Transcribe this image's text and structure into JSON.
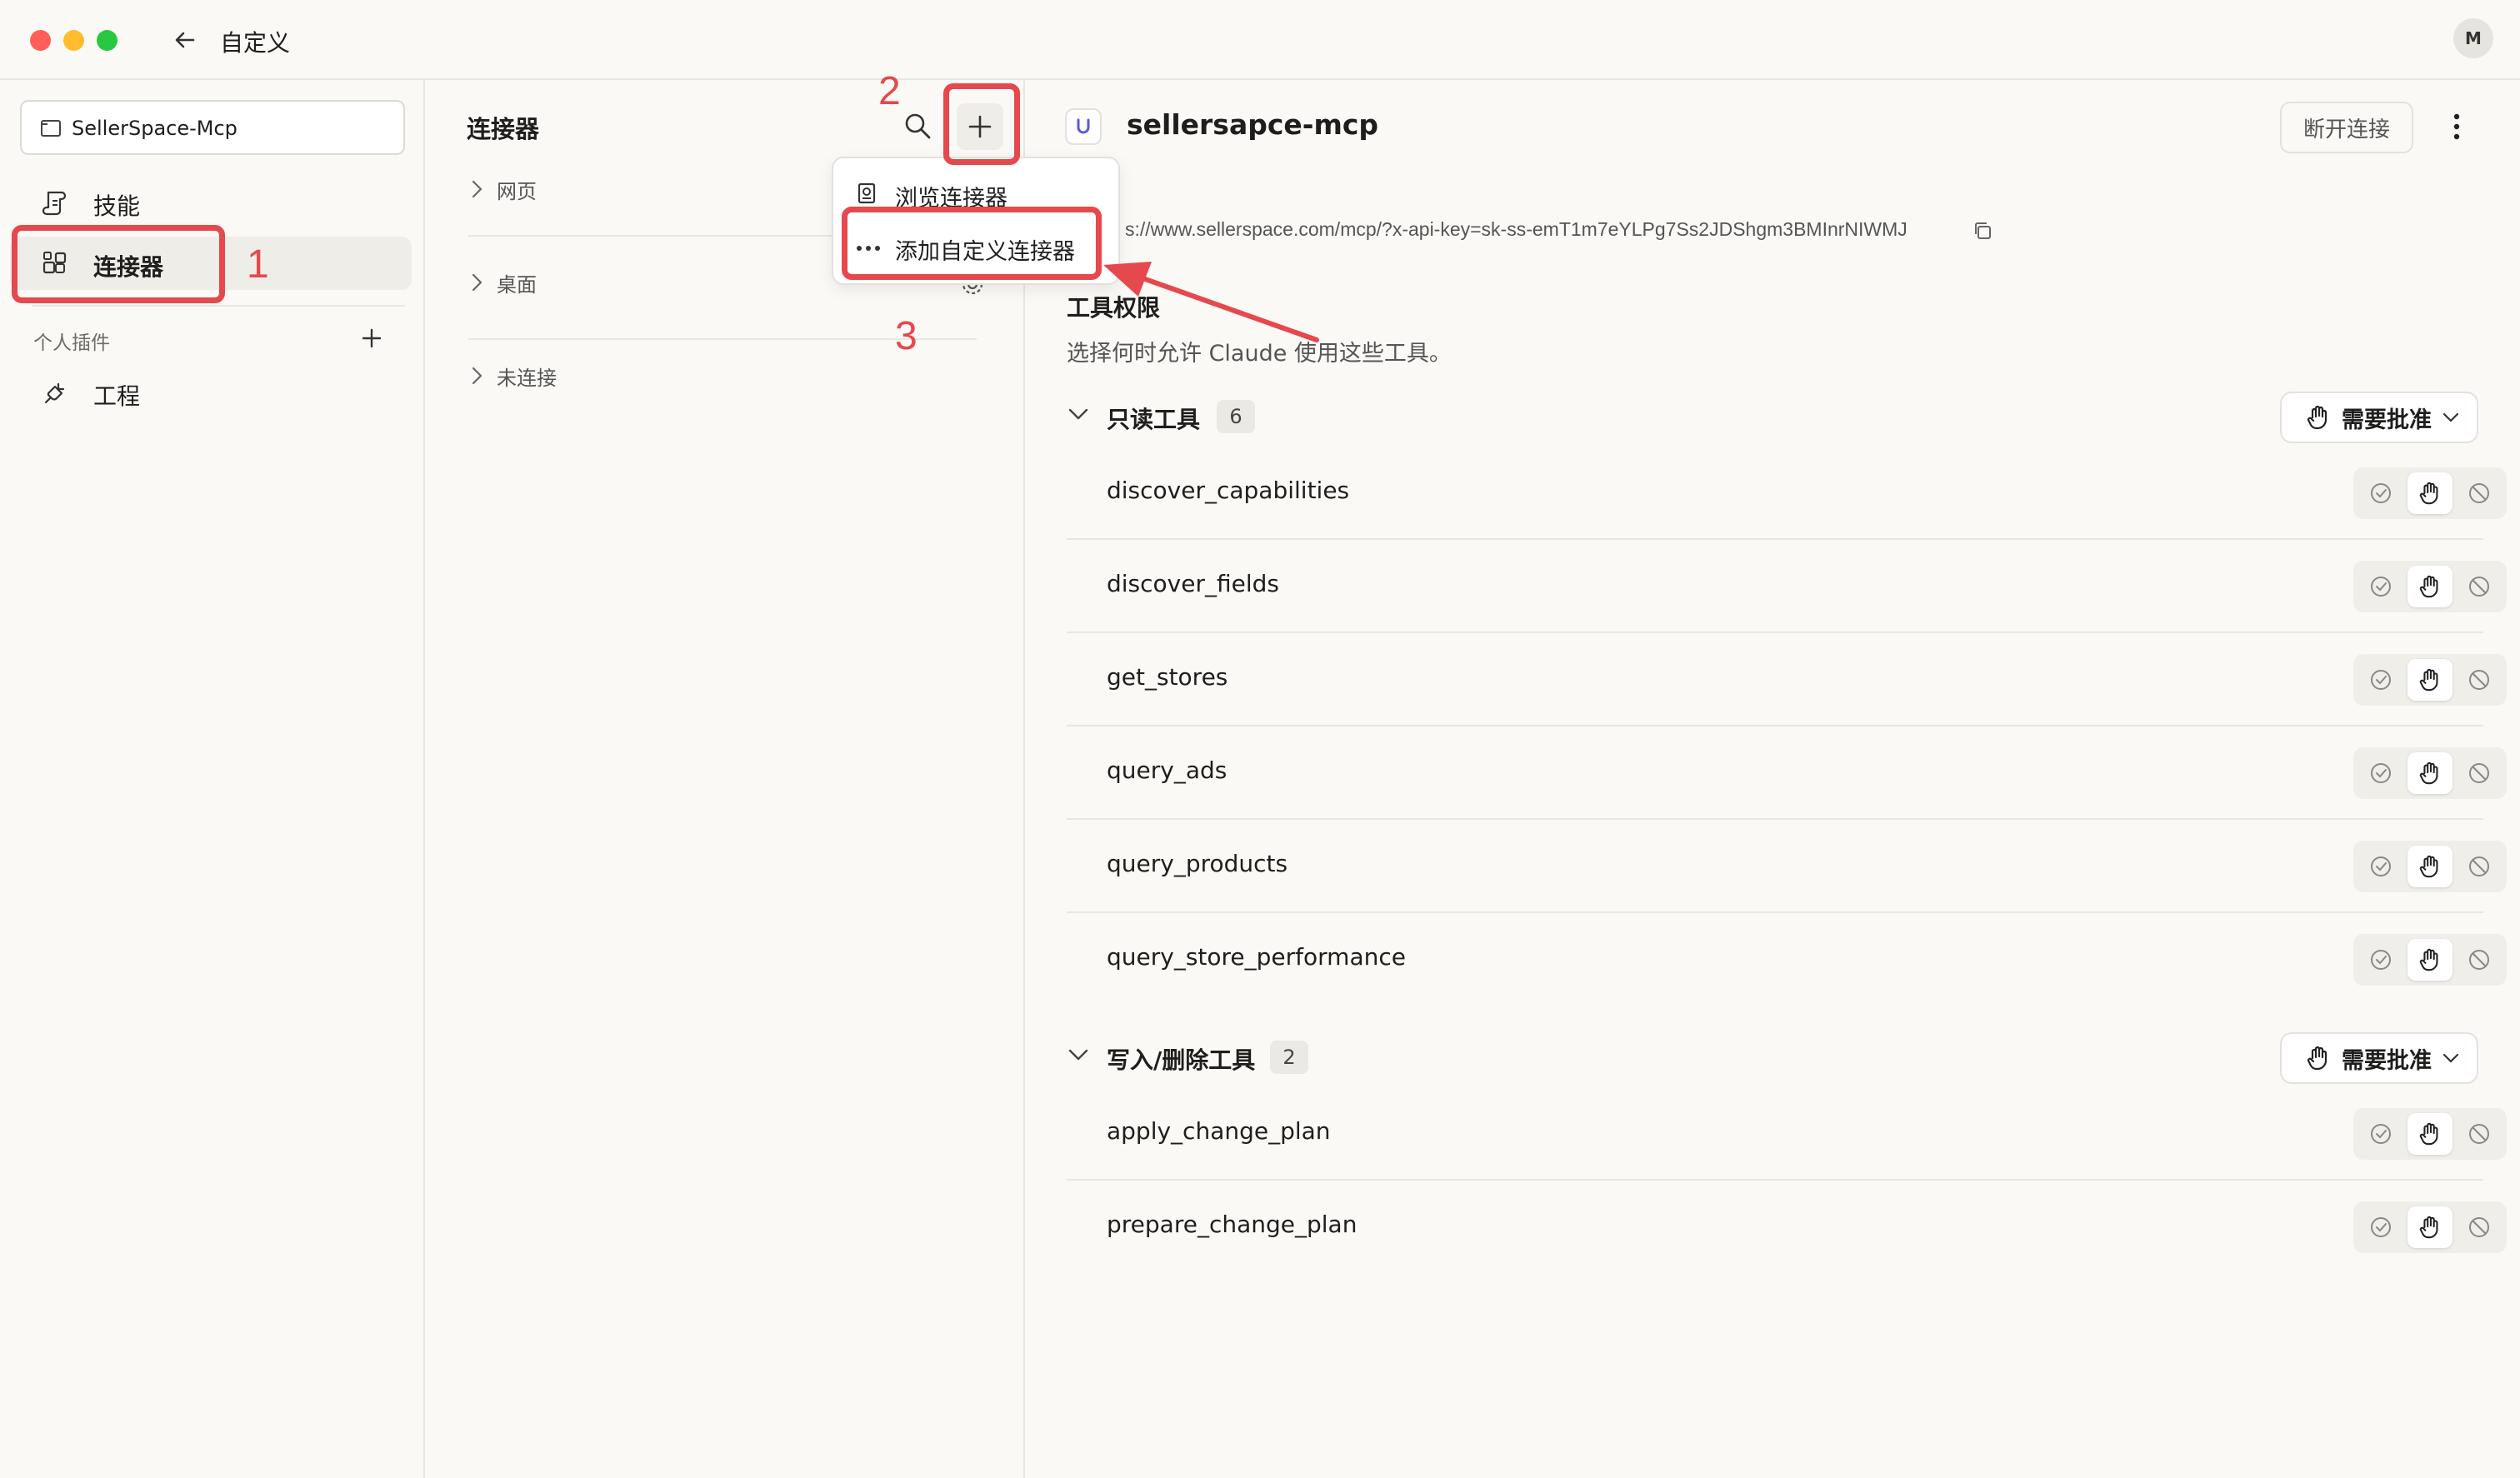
{
  "window": {
    "title": "自定义",
    "avatar": "M"
  },
  "sidebar": {
    "project": "SellerSpace-Mcp",
    "items": [
      {
        "label": "技能",
        "icon": "scroll-icon"
      },
      {
        "label": "连接器",
        "icon": "connectors-icon",
        "selected": true
      }
    ],
    "plugins_header": "个人插件",
    "plugins": [
      {
        "label": "工程",
        "icon": "plug-icon"
      }
    ]
  },
  "connectors_panel": {
    "title": "连接器",
    "sections": [
      "网页",
      "桌面",
      "未连接"
    ]
  },
  "dropdown_menu": {
    "items": [
      {
        "label": "浏览连接器",
        "icon": "browse-book-icon"
      },
      {
        "label": "添加自定义连接器",
        "icon": "more-dots-icon"
      }
    ]
  },
  "detail": {
    "name": "sellersapce-mcp",
    "disconnect_label": "断开连接",
    "url": "s://www.sellerspace.com/mcp/?x-api-key=sk-ss-emT1m7eYLPg7Ss2JDShgm3BMInrNIWMJ",
    "permissions_title": "工具权限",
    "permissions_desc": "选择何时允许 Claude 使用这些工具。",
    "groups": [
      {
        "label": "只读工具",
        "count": "6",
        "approval": "需要批准",
        "tools": [
          "discover_capabilities",
          "discover_fields",
          "get_stores",
          "query_ads",
          "query_products",
          "query_store_performance"
        ]
      },
      {
        "label": "写入/删除工具",
        "count": "2",
        "approval": "需要批准",
        "tools": [
          "apply_change_plan",
          "prepare_change_plan"
        ]
      }
    ]
  },
  "annotations": [
    "1",
    "2",
    "3"
  ],
  "colors": {
    "annotation_red": "#e5484d",
    "background": "#faf9f6",
    "selected_item": "#efede8"
  }
}
